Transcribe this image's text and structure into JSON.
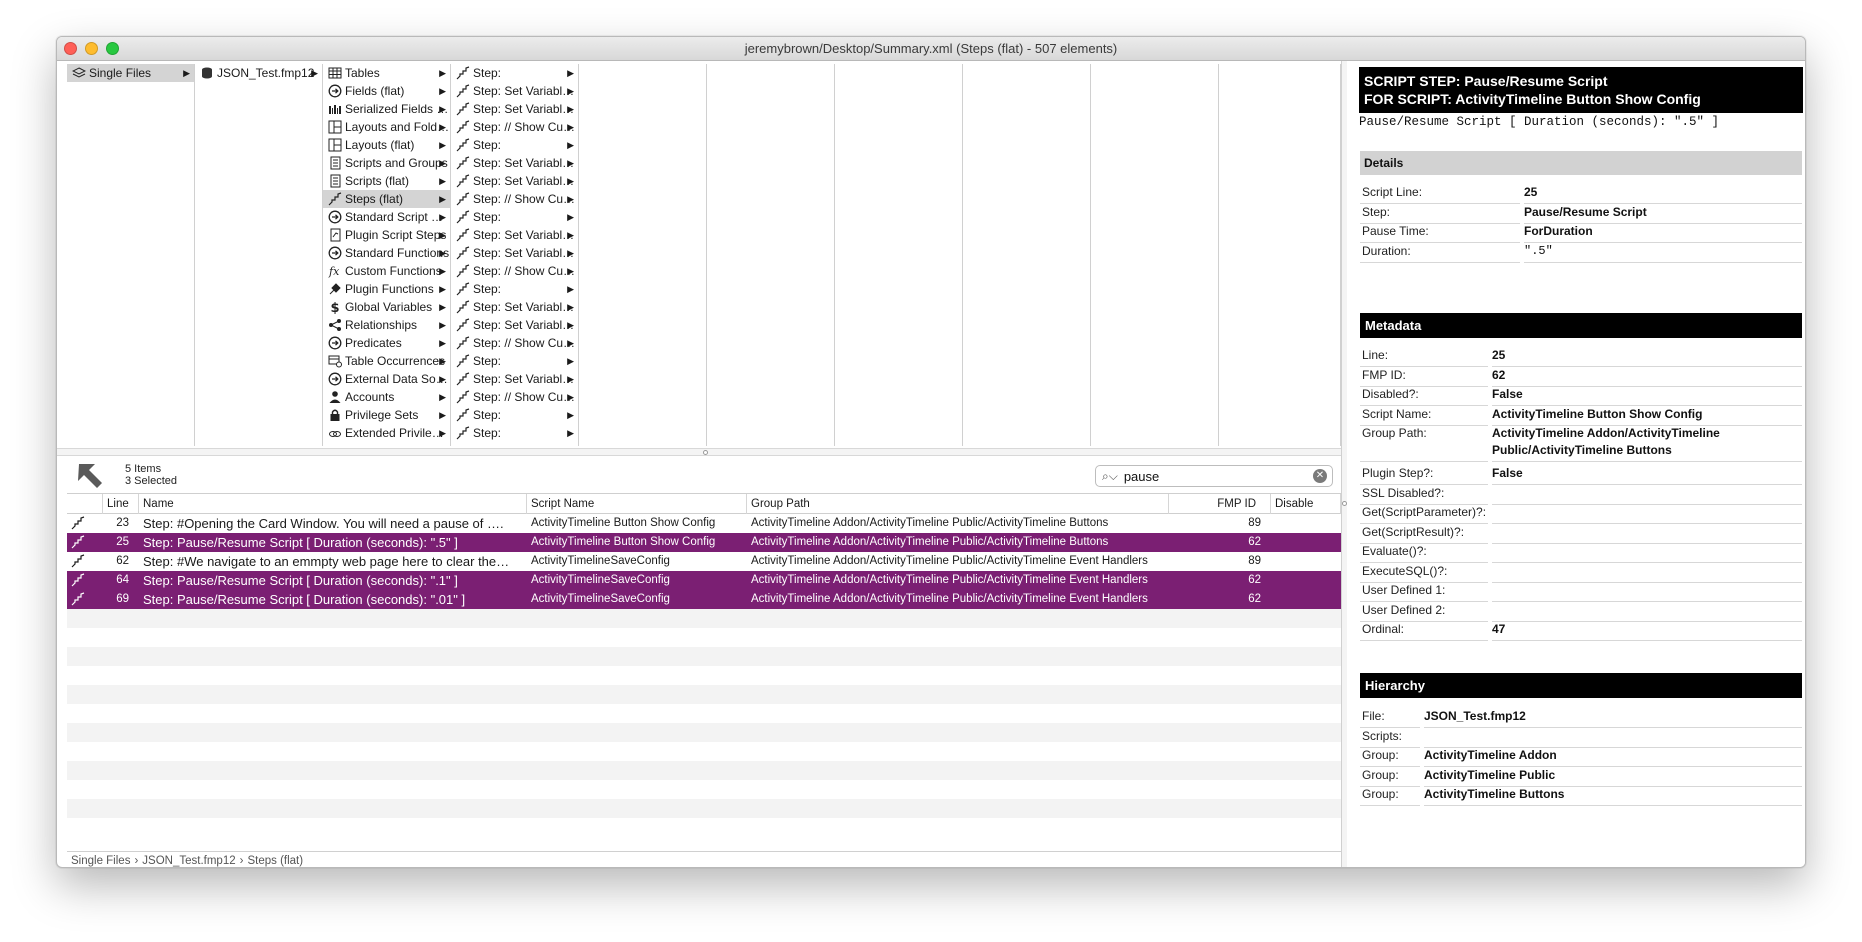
{
  "window": {
    "title": "jeremybrown/Desktop/Summary.xml  (Steps (flat) - 507 elements)"
  },
  "browser": {
    "col1": [
      {
        "label": "Single Files",
        "icon": "layers-icon"
      }
    ],
    "col2": [
      {
        "label": "JSON_Test.fmp12",
        "icon": "database-icon"
      }
    ],
    "col3": [
      {
        "label": "Tables",
        "icon": "table-icon"
      },
      {
        "label": "Fields (flat)",
        "icon": "circle-arrow-icon"
      },
      {
        "label": "Serialized Fields (flat)",
        "icon": "barcode-icon"
      },
      {
        "label": "Layouts and Folders",
        "icon": "layout-icon"
      },
      {
        "label": "Layouts (flat)",
        "icon": "layout-icon"
      },
      {
        "label": "Scripts and Groups",
        "icon": "script-icon"
      },
      {
        "label": "Scripts (flat)",
        "icon": "script-icon"
      },
      {
        "label": "Steps (flat)",
        "icon": "step-icon"
      },
      {
        "label": "Standard Script Steps",
        "icon": "circle-arrow-icon"
      },
      {
        "label": "Plugin Script Steps",
        "icon": "plugin-script-icon"
      },
      {
        "label": "Standard Functions",
        "icon": "circle-arrow-icon"
      },
      {
        "label": "Custom Functions",
        "icon": "function-icon"
      },
      {
        "label": "Plugin Functions",
        "icon": "plug-icon"
      },
      {
        "label": "Global Variables",
        "icon": "dollar-icon"
      },
      {
        "label": "Relationships",
        "icon": "share-icon"
      },
      {
        "label": "Predicates",
        "icon": "circle-arrow-icon"
      },
      {
        "label": "Table Occurrences",
        "icon": "table-occurrence-icon"
      },
      {
        "label": "External Data Sources",
        "icon": "circle-arrow-icon"
      },
      {
        "label": "Accounts",
        "icon": "person-icon"
      },
      {
        "label": "Privilege Sets",
        "icon": "lock-icon"
      },
      {
        "label": "Extended Privileges",
        "icon": "link-icon"
      }
    ],
    "col4": [
      "Step:",
      "Step: Set Variable [ $…",
      "Step: Set Variable [ $…",
      "Step: // Show Custo…",
      "Step:",
      "Step: Set Variable [ $…",
      "Step: Set Variable [ $…",
      "Step: // Show Custo…",
      "Step:",
      "Step: Set Variable [ $…",
      "Step: Set Variable [ $…",
      "Step: // Show Custo…",
      "Step:",
      "Step: Set Variable [ $…",
      "Step: Set Variable [ $…",
      "Step: // Show Custo…",
      "Step:",
      "Step: Set Variable [ $…",
      "Step: // Show Custo…",
      "Step:",
      "Step:"
    ]
  },
  "list": {
    "items_count": "5 Items",
    "selected_count": "3 Selected",
    "search_value": "pause",
    "columns": [
      "",
      "Line",
      "Name",
      "Script Name",
      "Group Path",
      "FMP ID",
      "Disable"
    ],
    "rows": [
      {
        "line": "23",
        "name": "Step: #Opening the Card Window.  You will need a pause of ….",
        "script": "ActivityTimeline Button Show Config",
        "group": "ActivityTimeline Addon/ActivityTimeline Public/ActivityTimeline Buttons",
        "fmp": "89",
        "selected": false
      },
      {
        "line": "25",
        "name": "Step: Pause/Resume Script [ Duration (seconds): \".5\" ]",
        "script": "ActivityTimeline Button Show Config",
        "group": "ActivityTimeline Addon/ActivityTimeline Public/ActivityTimeline Buttons",
        "fmp": "62",
        "selected": true
      },
      {
        "line": "62",
        "name": "Step: #We navigate to an emmpty web page here to clear the…",
        "script": "ActivityTimelineSaveConfig",
        "group": "ActivityTimeline Addon/ActivityTimeline Public/ActivityTimeline Event Handlers",
        "fmp": "89",
        "selected": false
      },
      {
        "line": "64",
        "name": "Step: Pause/Resume Script [ Duration (seconds): \".1\" ]",
        "script": "ActivityTimelineSaveConfig",
        "group": "ActivityTimeline Addon/ActivityTimeline Public/ActivityTimeline Event Handlers",
        "fmp": "62",
        "selected": true
      },
      {
        "line": "69",
        "name": "Step: Pause/Resume Script [ Duration (seconds): \".01\" ]",
        "script": "ActivityTimelineSaveConfig",
        "group": "ActivityTimeline Addon/ActivityTimeline Public/ActivityTimeline Event Handlers",
        "fmp": "62",
        "selected": true
      }
    ]
  },
  "breadcrumb": [
    "Single Files",
    "JSON_Test.fmp12",
    "Steps (flat)"
  ],
  "breadcrumb_sep": "›",
  "detail": {
    "header_line1": "SCRIPT STEP: Pause/Resume Script",
    "header_line2": "FOR SCRIPT: ActivityTimeline Button Show Config",
    "signature": "Pause/Resume Script [ Duration (seconds): \".5\" ]",
    "details_title": "Details",
    "details": [
      {
        "k": "Script Line:",
        "v": "25"
      },
      {
        "k": "Step:",
        "v": "Pause/Resume Script"
      },
      {
        "k": "Pause Time:",
        "v": "ForDuration"
      },
      {
        "k": "Duration:",
        "v": "\".5\""
      }
    ],
    "metadata_title": "Metadata",
    "metadata": [
      {
        "k": "Line:",
        "v": "25"
      },
      {
        "k": "FMP ID:",
        "v": "62"
      },
      {
        "k": "Disabled?:",
        "v": "False"
      },
      {
        "k": "Script Name:",
        "v": "ActivityTimeline Button Show Config"
      },
      {
        "k": "Group Path:",
        "v": "ActivityTimeline Addon/ActivityTimeline Public/ActivityTimeline Buttons"
      },
      {
        "k": "Plugin Step?:",
        "v": "False"
      },
      {
        "k": "SSL Disabled?:",
        "v": ""
      },
      {
        "k": "Get(ScriptParameter)?:",
        "v": ""
      },
      {
        "k": "Get(ScriptResult)?:",
        "v": ""
      },
      {
        "k": "Evaluate()?:",
        "v": ""
      },
      {
        "k": "ExecuteSQL()?:",
        "v": ""
      },
      {
        "k": "User Defined 1:",
        "v": ""
      },
      {
        "k": "User Defined 2:",
        "v": ""
      },
      {
        "k": "Ordinal:",
        "v": "47"
      }
    ],
    "hierarchy_title": "Hierarchy",
    "hierarchy": [
      {
        "k": "File:",
        "v": "JSON_Test.fmp12"
      },
      {
        "k": "Scripts:",
        "v": ""
      },
      {
        "k": "Group:",
        "v": "ActivityTimeline Addon"
      },
      {
        "k": "Group:",
        "v": "ActivityTimeline Public"
      },
      {
        "k": "Group:",
        "v": "ActivityTimeline Buttons"
      }
    ]
  },
  "colors": {
    "selection": "#7b1f73",
    "header": "#000000",
    "section_gray": "#d2d2d2"
  }
}
